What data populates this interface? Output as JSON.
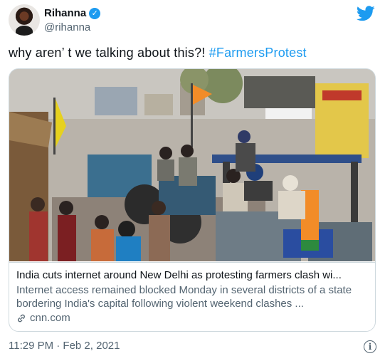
{
  "author": {
    "display_name": "Rihanna",
    "handle": "@rihanna",
    "verified_glyph": "✓"
  },
  "tweet": {
    "text_plain": "why aren’ t we talking about this?! ",
    "hashtag": "#FarmersProtest"
  },
  "card": {
    "title": "India cuts internet around New Delhi as protesting farmers clash wi...",
    "description": "Internet access remained blocked Monday in several districts of a state bordering India's capital following violent weekend clashes ...",
    "domain": "cnn.com"
  },
  "meta": {
    "timestamp": "11:29 PM · Feb 2, 2021",
    "info_glyph": "i"
  },
  "colors": {
    "accent": "#1d9bf0",
    "secondary_text": "#536471",
    "border": "#cfd9de"
  },
  "icons": [
    "twitter-bird-icon",
    "verified-badge-icon",
    "link-icon",
    "info-icon"
  ]
}
